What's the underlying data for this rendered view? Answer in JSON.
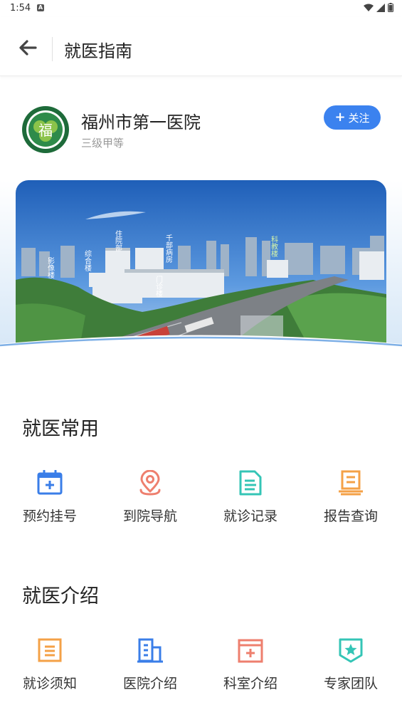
{
  "status": {
    "time": "1:54",
    "notification": "A"
  },
  "appbar": {
    "title": "就医指南"
  },
  "hospital": {
    "name": "福州市第一医院",
    "level": "三级甲等",
    "follow_label": "关注",
    "logo_text": "福"
  },
  "banner": {
    "building_labels": [
      "住院部",
      "千部病房",
      "综合楼",
      "影像楼",
      "门诊楼",
      "科教楼"
    ],
    "page_count": 2,
    "current_page": 1
  },
  "sections": [
    {
      "title": "就医常用",
      "items": [
        {
          "label": "预约挂号",
          "icon": "calendar-plus-icon",
          "color": "#3a7ee8"
        },
        {
          "label": "到院导航",
          "icon": "location-pin-icon",
          "color": "#ee7f6e"
        },
        {
          "label": "就诊记录",
          "icon": "document-list-icon",
          "color": "#34c5b6"
        },
        {
          "label": "报告查询",
          "icon": "report-monitor-icon",
          "color": "#f4a147"
        }
      ]
    },
    {
      "title": "就医介绍",
      "items": [
        {
          "label": "就诊须知",
          "icon": "notice-icon",
          "color": "#f4a147"
        },
        {
          "label": "医院介绍",
          "icon": "building-icon",
          "color": "#3a7ee8"
        },
        {
          "label": "科室介绍",
          "icon": "department-icon",
          "color": "#ee7f6e"
        },
        {
          "label": "专家团队",
          "icon": "star-badge-icon",
          "color": "#34c5b6"
        }
      ]
    }
  ]
}
